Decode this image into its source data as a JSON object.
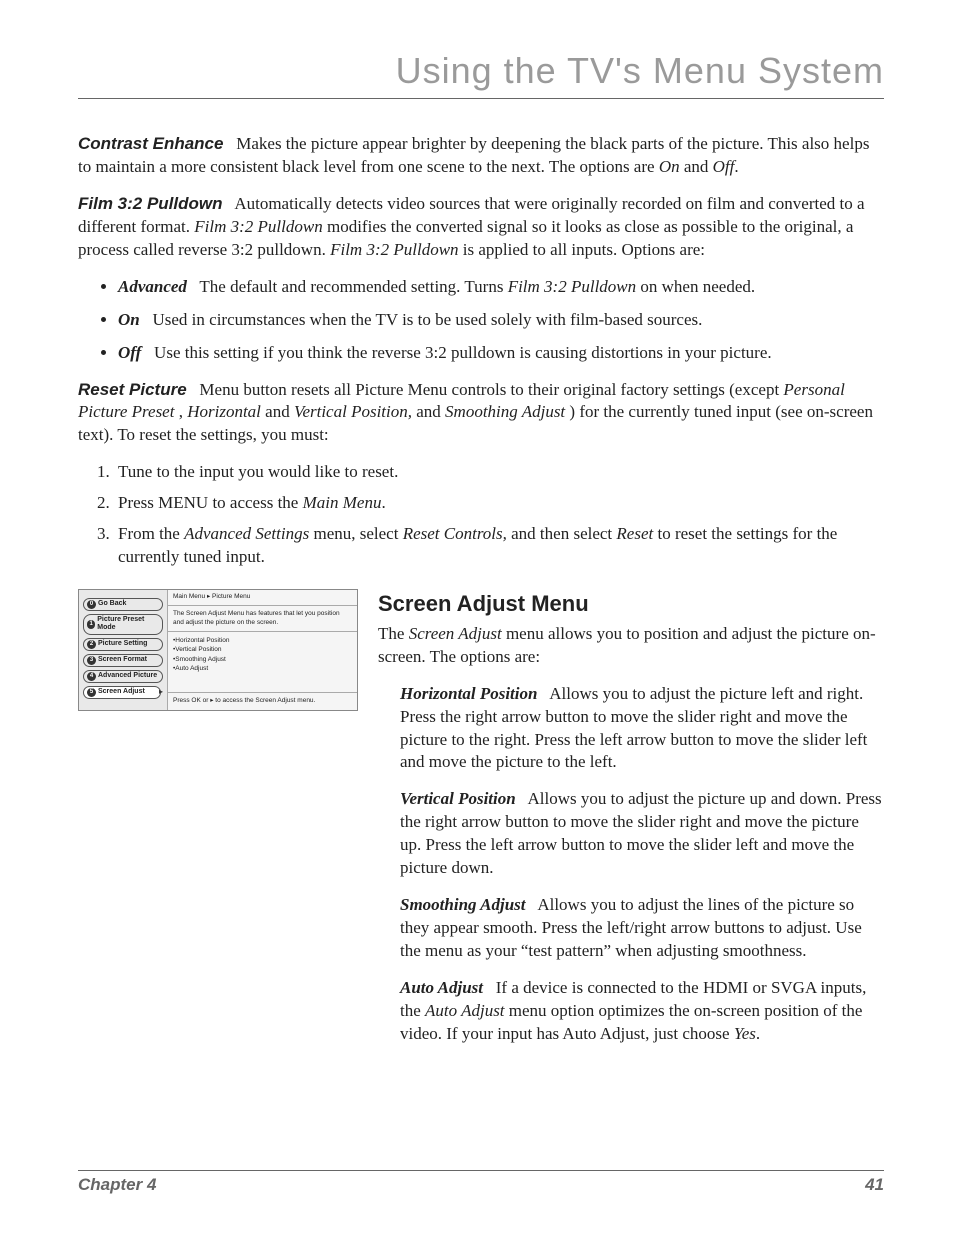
{
  "header": {
    "title": "Using the TV's Menu System"
  },
  "contrast_enhance": {
    "label": "Contrast Enhance",
    "text1": "Makes the picture appear brighter by deepening the black parts of the picture. This also helps to maintain a more consistent black level from one scene to the next. The options are ",
    "on": "On",
    "and": " and ",
    "off": "Off",
    "tail": "."
  },
  "film": {
    "label": "Film 3:2 Pulldown",
    "text1": "Automatically detects video sources that were originally recorded on film and converted to a different format. ",
    "ital1": "Film 3:2 Pulldown",
    "text2": " modifies the converted signal so it looks as close as possible to the original, a process called reverse 3:2 pulldown. ",
    "ital2": "Film 3:2 Pulldown",
    "text3": " is applied to all inputs. Options are:",
    "adv_label": "Advanced",
    "adv_text1": "The default and recommended setting. Turns ",
    "adv_ital": "Film 3:2 Pulldown",
    "adv_text2": " on when needed.",
    "on_label": "On",
    "on_text": "Used in circumstances when the TV is to be used solely with film-based sources.",
    "off_label": "Off",
    "off_text": "Use this setting if you think the reverse 3:2 pulldown is causing distortions in your picture."
  },
  "reset": {
    "label": "Reset Picture",
    "text1": "Menu button resets all Picture Menu controls to their original factory settings (except ",
    "i1": "Personal Picture Preset",
    "c1": ", ",
    "i2": "Horizontal",
    "c2": " and ",
    "i3": "Vertical Position,",
    "c3": " and ",
    "i4": "Smoothing Adjust",
    "text2": ") for the currently tuned input (see on-screen text). To reset the settings, you must:",
    "step1": "Tune to the input you would like to reset.",
    "step2a": "Press MENU to access the ",
    "step2i": "Main Menu",
    "step2b": ".",
    "step3a": "From the ",
    "step3i1": "Advanced Settings",
    "step3b": " menu, select ",
    "step3i2": "Reset Controls,",
    "step3c": " and then select ",
    "step3i3": "Reset",
    "step3d": " to reset the settings for the currently tuned input."
  },
  "screenshot": {
    "crumb": "Main Menu ▸ Picture Menu",
    "desc": "The Screen Adjust Menu has features that let you position and adjust the picture on the screen.",
    "items": {
      "a": "•Horizontal Position",
      "b": "•Vertical Position",
      "c": "•Smoothing Adjust",
      "d": "•Auto Adjust"
    },
    "hint": "Press OK or ▸ to access the Screen Adjust menu.",
    "nav": {
      "n0": "Go Back",
      "n1": "Picture Preset Mode",
      "n2": "Picture Setting",
      "n3": "Screen Format",
      "n4": "Advanced Picture",
      "n5": "Screen Adjust"
    }
  },
  "screen_adjust": {
    "title": "Screen Adjust Menu",
    "intro_a": "The ",
    "intro_i": "Screen Adjust",
    "intro_b": " menu allows you to position and adjust the picture on-screen. The options are:",
    "hp_label": "Horizontal Position",
    "hp_text": "Allows you to adjust the picture left and right. Press the right arrow button to move the slider right and move the picture to the right. Press the left arrow button to move the slider left and move the picture to the left.",
    "vp_label": "Vertical Position",
    "vp_text": "Allows you to adjust the picture up and down. Press the right arrow button to move the slider right and move the picture up. Press the left arrow button to move the slider left and move the picture down.",
    "sa_label": "Smoothing Adjust",
    "sa_text": "Allows you to adjust the lines of the picture so they appear smooth. Press the left/right arrow buttons to adjust. Use the menu as your “test pattern” when adjusting smoothness.",
    "aa_label": "Auto Adjust",
    "aa_text1": "If a device is connected to the HDMI or SVGA inputs, the ",
    "aa_ital": "Auto Adjust",
    "aa_text2": " menu option optimizes the on-screen position of the video. If your input has Auto Adjust, just choose ",
    "aa_yes": "Yes",
    "aa_tail": "."
  },
  "footer": {
    "left": "Chapter 4",
    "right": "41"
  }
}
